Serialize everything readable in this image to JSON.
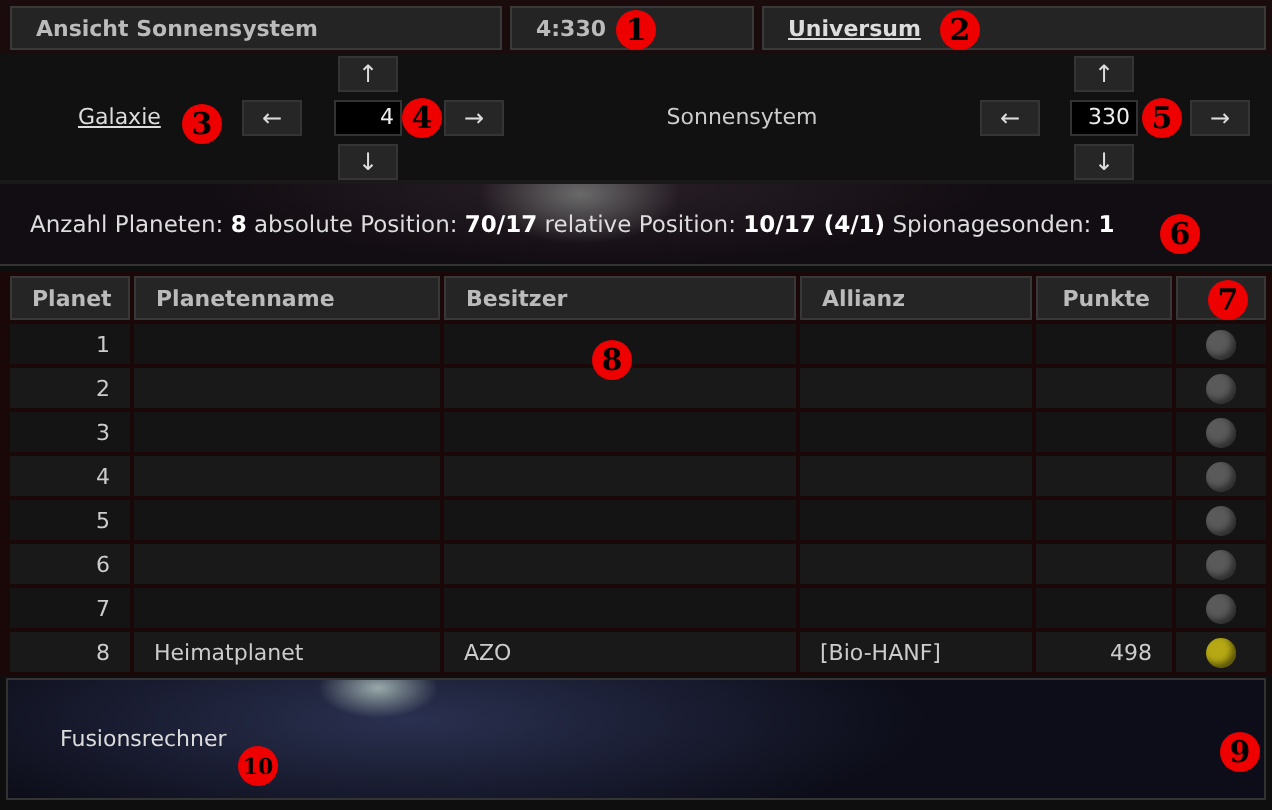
{
  "header": {
    "title": "Ansicht Sonnensystem",
    "coordinates": "4:330",
    "link": "Universum"
  },
  "navigation": {
    "galaxy_link": "Galaxie",
    "galaxy_value": "4",
    "system_label": "Sonnensytem",
    "system_value": "330",
    "up": "↑",
    "down": "↓",
    "left": "←",
    "right": "→"
  },
  "info": "Anzahl Planeten: **8** absolute Position: **70/17** relative Position: **10/17 (4/1)** Spionagesonden: **1**",
  "table": {
    "columns": [
      "Planet",
      "Planetenname",
      "Besitzer",
      "Allianz",
      "Punkte"
    ],
    "rows": [
      {
        "planet": "1",
        "color": "#5a5a5a"
      },
      {
        "planet": "2",
        "color": "#5a5a5a"
      },
      {
        "planet": "3",
        "color": "#5a5a5a"
      },
      {
        "planet": "4",
        "color": "#5a5a5a"
      },
      {
        "planet": "5",
        "color": "#5a5a5a"
      },
      {
        "planet": "6",
        "color": "#5a5a5a"
      },
      {
        "planet": "7",
        "color": "#5a5a5a"
      },
      {
        "planet": "8",
        "name": "Heimatplanet",
        "owner": "AZO",
        "alliance": "[Bio-HANF]",
        "points": "498",
        "color": "#b5a814"
      }
    ]
  },
  "footer": {
    "link": "Fusionsrechner"
  },
  "callouts": [
    "1",
    "2",
    "3",
    "4",
    "5",
    "6",
    "7",
    "8",
    "9",
    "10"
  ]
}
